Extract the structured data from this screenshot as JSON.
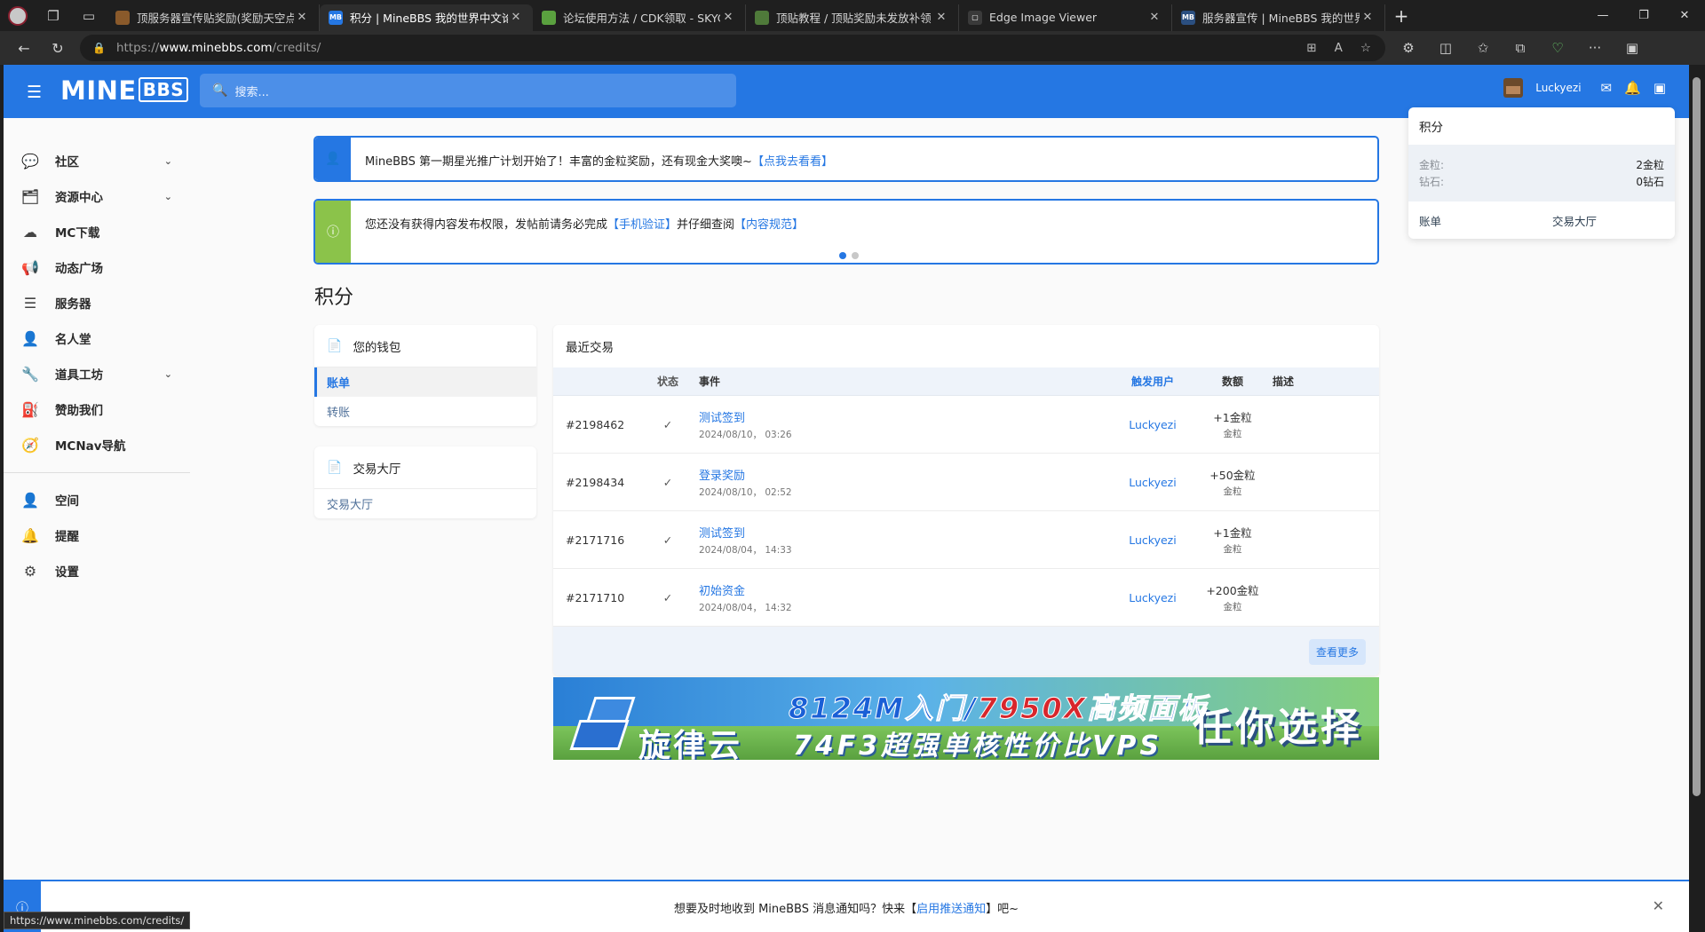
{
  "browser": {
    "tabs": [
      {
        "title": "顶服务器宣传贴奖励(奖励天空点",
        "fav_color": "#8a5a2b",
        "fav_text": ""
      },
      {
        "title": "积分 | MineBBS 我的世界中文论坛",
        "fav_color": "#2577e3",
        "fav_text": "MB",
        "active": true
      },
      {
        "title": "论坛使用方法 / CDK领取 - SKYCI",
        "fav_color": "#5aa13f",
        "fav_text": ""
      },
      {
        "title": "顶贴教程 / 顶贴奖励未发放补领",
        "fav_color": "#4f7a3a",
        "fav_text": ""
      },
      {
        "title": "Edge Image Viewer",
        "fav_color": "#3a3a3a",
        "fav_text": "▢"
      },
      {
        "title": "服务器宣传 | MineBBS 我的世界中",
        "fav_color": "#2b4f80",
        "fav_text": "MB"
      }
    ],
    "url_prefix": "https://",
    "url_host": "www.minebbs.com",
    "url_path": "/credits/",
    "status_url": "https://www.minebbs.com/credits/"
  },
  "site": {
    "logo_main": "MINE",
    "logo_box": "BBS",
    "search_placeholder": "搜索...",
    "username": "Luckyezi"
  },
  "sidebar": {
    "items": [
      {
        "label": "社区",
        "icon": "💬",
        "chevron": true
      },
      {
        "label": "资源中心",
        "icon": "🗂",
        "chevron": true
      },
      {
        "label": "MC下载",
        "icon": "☁",
        "chevron": false
      },
      {
        "label": "动态广场",
        "icon": "📢",
        "chevron": false
      },
      {
        "label": "服务器",
        "icon": "☰",
        "chevron": false
      },
      {
        "label": "名人堂",
        "icon": "👤",
        "chevron": false
      },
      {
        "label": "道具工坊",
        "icon": "🔧",
        "chevron": true
      },
      {
        "label": "赞助我们",
        "icon": "⛽",
        "chevron": false
      },
      {
        "label": "MCNav导航",
        "icon": "🧭",
        "chevron": false
      }
    ],
    "items2": [
      {
        "label": "空间",
        "icon": "👤"
      },
      {
        "label": "提醒",
        "icon": "🔔"
      },
      {
        "label": "设置",
        "icon": "⚙"
      }
    ]
  },
  "notices": {
    "first_text": "MineBBS 第一期星光推广计划开始了！丰富的金粒奖励，还有现金大奖噢~",
    "first_link": "【点我去看看】",
    "second_pre": "您还没有获得内容发布权限，发帖前请务必完成",
    "second_link1": "【手机验证】",
    "second_mid": "并仔细查阅",
    "second_link2": "【内容规范】"
  },
  "page": {
    "title": "积分"
  },
  "wallet": {
    "title": "您的钱包",
    "links": [
      "账单",
      "转账"
    ],
    "market_title": "交易大厅",
    "market_links": [
      "交易大厅"
    ]
  },
  "transactions": {
    "title": "最近交易",
    "headers": {
      "status": "状态",
      "event": "事件",
      "user": "触发用户",
      "amount": "数额",
      "desc": "描述"
    },
    "rows": [
      {
        "id": "#2198462",
        "status": "✓",
        "event": "测试签到",
        "date": "2024/08/10， 03:26",
        "user": "Luckyezi",
        "amount": "+1金粒",
        "unit": "金粒"
      },
      {
        "id": "#2198434",
        "status": "✓",
        "event": "登录奖励",
        "date": "2024/08/10， 02:52",
        "user": "Luckyezi",
        "amount": "+50金粒",
        "unit": "金粒"
      },
      {
        "id": "#2171716",
        "status": "✓",
        "event": "测试签到",
        "date": "2024/08/04， 14:33",
        "user": "Luckyezi",
        "amount": "+1金粒",
        "unit": "金粒"
      },
      {
        "id": "#2171710",
        "status": "✓",
        "event": "初始资金",
        "date": "2024/08/04， 14:32",
        "user": "Luckyezi",
        "amount": "+200金粒",
        "unit": "金粒"
      }
    ],
    "more": "查看更多"
  },
  "banner": {
    "line1a": "8124M入门/",
    "line1b": "7950X",
    "line1c": "高频面板",
    "brand": "旋律云",
    "line2": "74F3超强单核性价比VPS",
    "slogan": "任你选择"
  },
  "credits_panel": {
    "title": "积分",
    "lines": [
      {
        "k": "金粒:",
        "v": "2金粒"
      },
      {
        "k": "钻石:",
        "v": "0钻石"
      }
    ],
    "foot": [
      "账单",
      "交易大厅"
    ]
  },
  "push": {
    "pre": "想要及时地收到 MineBBS 消息通知吗？快来【",
    "link": "启用推送通知",
    "post": "】吧~"
  },
  "colors": {
    "accent": "#2577e3",
    "green": "#8bc34a"
  }
}
